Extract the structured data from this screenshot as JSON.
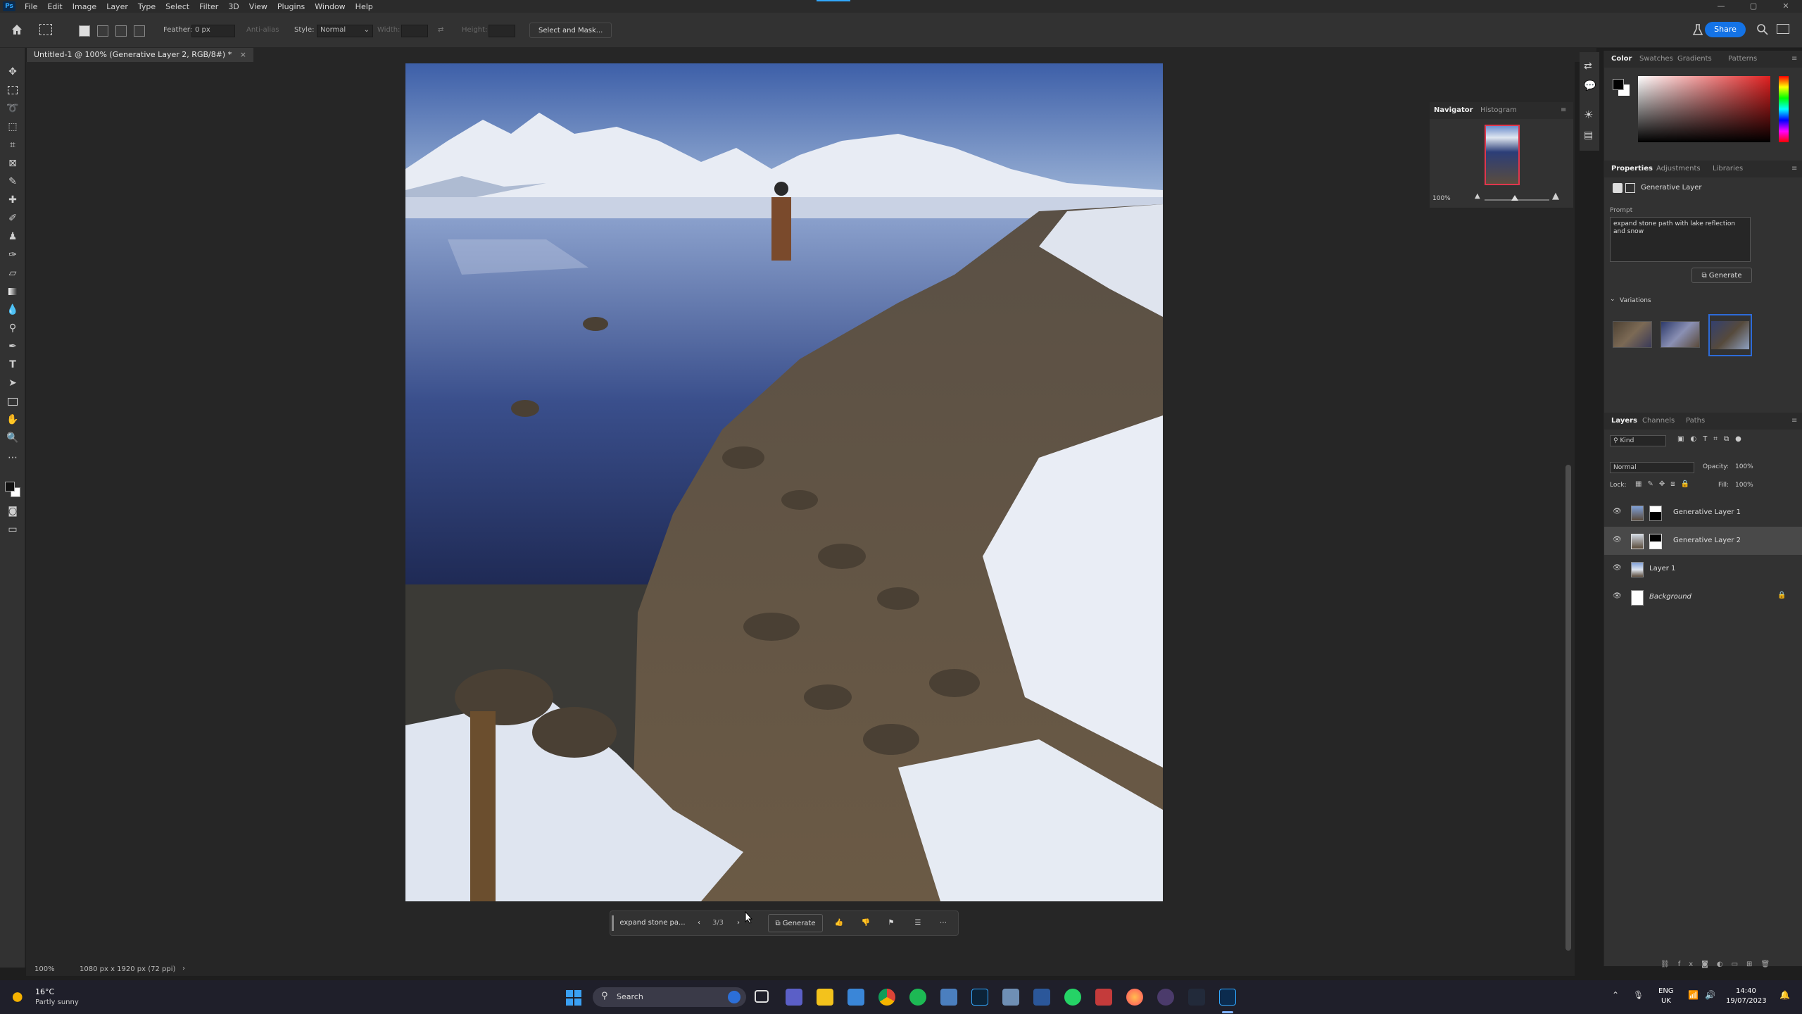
{
  "app": {
    "logo_text": "Ps"
  },
  "menu": [
    "File",
    "Edit",
    "Image",
    "Layer",
    "Type",
    "Select",
    "Filter",
    "3D",
    "View",
    "Plugins",
    "Window",
    "Help"
  ],
  "window_controls": [
    "—",
    "▢",
    "✕"
  ],
  "options": {
    "feather_label": "Feather:",
    "feather_value": "0 px",
    "anti_alias": "Anti-alias",
    "style_label": "Style:",
    "style_value": "Normal",
    "width_label": "Width:",
    "height_label": "Height:",
    "select_mask": "Select and Mask...",
    "share": "Share"
  },
  "document": {
    "tab_title": "Untitled-1 @ 100% (Generative Layer 2, RGB/8#) *",
    "close_glyph": "×"
  },
  "status": {
    "zoom": "100%",
    "size": "1080 px x 1920 px (72 ppi)"
  },
  "contextual_bar": {
    "prompt": "expand stone pa...",
    "counter": "3/3",
    "generate": "Generate"
  },
  "navigator": {
    "tabs": [
      "Navigator",
      "Histogram"
    ],
    "zoom": "100%"
  },
  "color_panel": {
    "tabs": [
      "Color",
      "Swatches",
      "Gradients",
      "Patterns"
    ]
  },
  "properties": {
    "tabs": [
      "Properties",
      "Adjustments",
      "Libraries"
    ],
    "layer_type": "Generative Layer",
    "prompt_label": "Prompt",
    "prompt_text": "expand stone path with lake reflection and snow",
    "generate": "Generate",
    "variations_label": "Variations"
  },
  "layers_panel": {
    "tabs": [
      "Layers",
      "Channels",
      "Paths"
    ],
    "kind": "Kind",
    "blend_mode": "Normal",
    "opacity_label": "Opacity:",
    "opacity_value": "100%",
    "lock_label": "Lock:",
    "fill_label": "Fill:",
    "fill_value": "100%",
    "layers": [
      {
        "name": "Generative Layer 1",
        "selected": false
      },
      {
        "name": "Generative Layer 2",
        "selected": true
      },
      {
        "name": "Layer 1",
        "selected": false
      },
      {
        "name": "Background",
        "selected": false
      }
    ]
  },
  "taskbar": {
    "weather_temp": "16°C",
    "weather_desc": "Partly sunny",
    "search_placeholder": "Search",
    "lang": "ENG",
    "region": "UK",
    "time": "14:40",
    "date": "19/07/2023"
  },
  "colors": {
    "accent": "#31a8ff",
    "share_blue": "#1473e6",
    "selected_variation": "#2d6bd8"
  }
}
